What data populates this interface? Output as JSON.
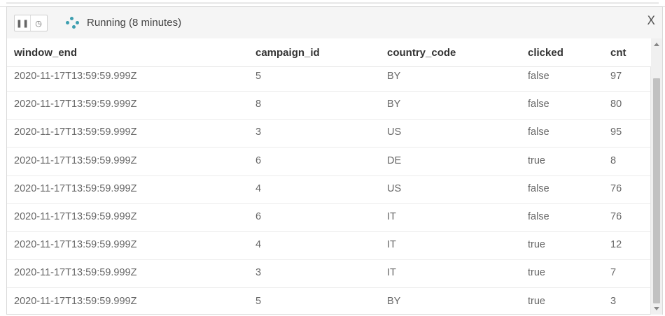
{
  "toolbar": {
    "pause_icon": "pause-icon",
    "clock_icon": "clock-icon",
    "status": "Running (8 minutes)",
    "close_label": "X"
  },
  "table": {
    "columns": [
      "window_end",
      "campaign_id",
      "country_code",
      "clicked",
      "cnt"
    ],
    "rows": [
      [
        "2020-11-17T13:59:59.999Z",
        "5",
        "BY",
        "false",
        "97"
      ],
      [
        "2020-11-17T13:59:59.999Z",
        "8",
        "BY",
        "false",
        "80"
      ],
      [
        "2020-11-17T13:59:59.999Z",
        "3",
        "US",
        "false",
        "95"
      ],
      [
        "2020-11-17T13:59:59.999Z",
        "6",
        "DE",
        "true",
        "8"
      ],
      [
        "2020-11-17T13:59:59.999Z",
        "4",
        "US",
        "false",
        "76"
      ],
      [
        "2020-11-17T13:59:59.999Z",
        "6",
        "IT",
        "false",
        "76"
      ],
      [
        "2020-11-17T13:59:59.999Z",
        "4",
        "IT",
        "true",
        "12"
      ],
      [
        "2020-11-17T13:59:59.999Z",
        "3",
        "IT",
        "true",
        "7"
      ],
      [
        "2020-11-17T13:59:59.999Z",
        "5",
        "BY",
        "true",
        "3"
      ]
    ]
  },
  "colors": {
    "spinner": "#3d9fb0",
    "toolbar_bg": "#f5f5f5"
  }
}
